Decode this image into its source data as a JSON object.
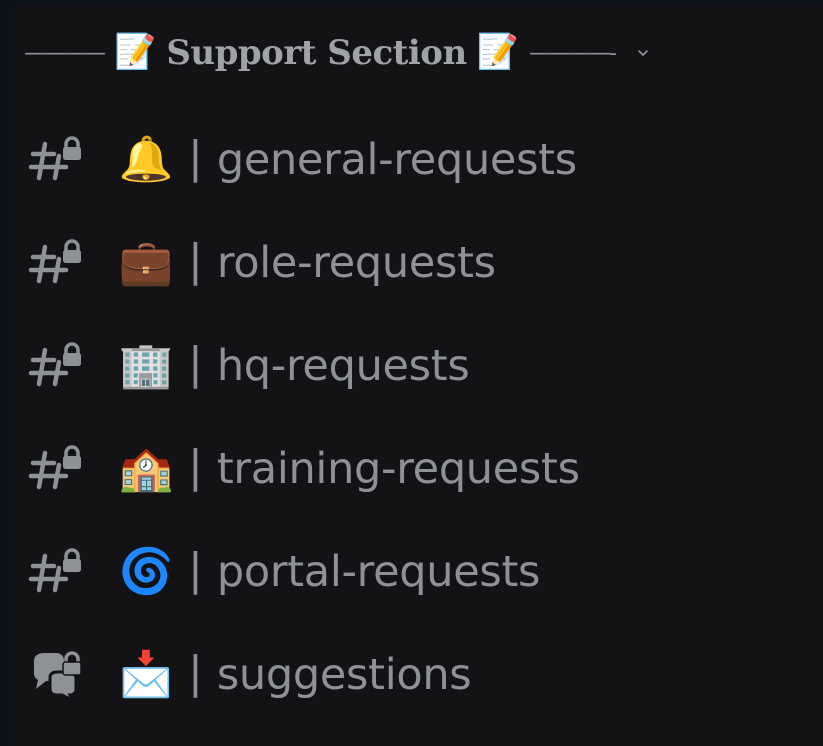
{
  "category": {
    "dashes_left": "————",
    "emoji_left": "📝",
    "title": "Support Section",
    "emoji_right": "📝",
    "dashes_right": "————-"
  },
  "channels": [
    {
      "type": "locked-text-channel",
      "emoji": "🔔",
      "separator": "|",
      "name": "general-requests"
    },
    {
      "type": "locked-text-channel",
      "emoji": "💼",
      "separator": "|",
      "name": "role-requests"
    },
    {
      "type": "locked-text-channel",
      "emoji": "🏢",
      "separator": "|",
      "name": "hq-requests"
    },
    {
      "type": "locked-text-channel",
      "emoji": "🏫",
      "separator": "|",
      "name": "training-requests"
    },
    {
      "type": "locked-text-channel",
      "emoji": "🌀",
      "separator": "|",
      "name": "portal-requests"
    },
    {
      "type": "locked-forum-channel",
      "emoji": "📩",
      "separator": "|",
      "name": "suggestions"
    }
  ],
  "colors": {
    "background": "#131316",
    "frame": "#0b1218",
    "text_muted": "#8e9297",
    "icon": "#8e9297"
  }
}
